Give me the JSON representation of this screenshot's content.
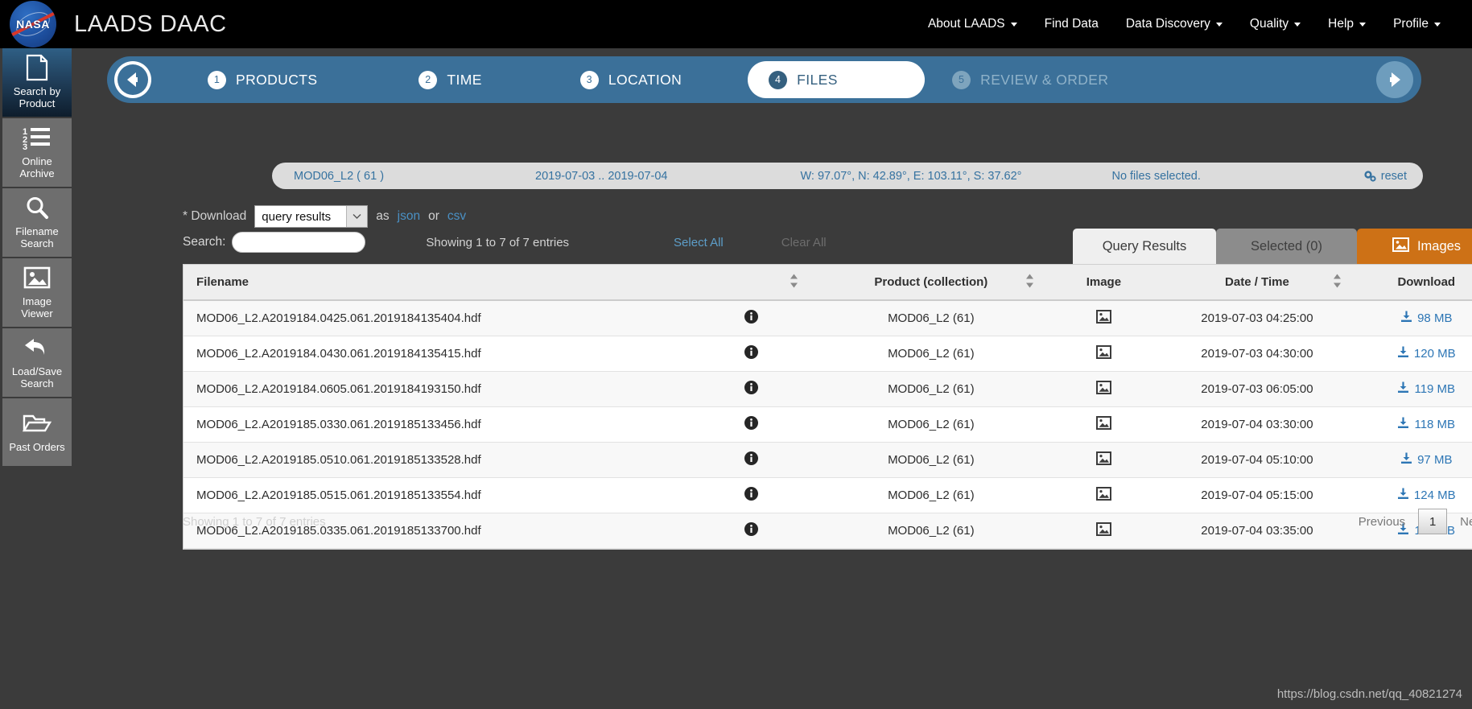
{
  "header": {
    "brand": "LAADS DAAC",
    "logo_text": "NASA",
    "nav": [
      {
        "label": "About LAADS",
        "caret": true
      },
      {
        "label": "Find Data",
        "caret": false
      },
      {
        "label": "Data Discovery",
        "caret": true
      },
      {
        "label": "Quality",
        "caret": true
      },
      {
        "label": "Help",
        "caret": true
      },
      {
        "label": "Profile",
        "caret": true
      }
    ]
  },
  "sidebar": {
    "items": [
      {
        "label_1": "Search by",
        "label_2": "Product",
        "icon": "document-icon",
        "active": true
      },
      {
        "label_1": "Online",
        "label_2": "Archive",
        "icon": "ordered-list-icon",
        "active": false
      },
      {
        "label_1": "Filename",
        "label_2": "Search",
        "icon": "search-icon",
        "active": false
      },
      {
        "label_1": "Image",
        "label_2": "Viewer",
        "icon": "image-icon",
        "active": false
      },
      {
        "label_1": "Load/Save",
        "label_2": "Search",
        "icon": "undo-arrow-icon",
        "active": false
      },
      {
        "label_1": "Past Orders",
        "label_2": "",
        "icon": "folder-open-icon",
        "active": false
      }
    ]
  },
  "stepper": {
    "back_icon": "arrow-left-circle-icon",
    "next_icon": "arrow-right-circle-icon",
    "steps": [
      {
        "num": "1",
        "label": "PRODUCTS",
        "state": "done"
      },
      {
        "num": "2",
        "label": "TIME",
        "state": "done"
      },
      {
        "num": "3",
        "label": "LOCATION",
        "state": "done"
      },
      {
        "num": "4",
        "label": "FILES",
        "state": "current"
      },
      {
        "num": "5",
        "label": "REVIEW & ORDER",
        "state": "disabled"
      }
    ]
  },
  "summary": {
    "product": "MOD06_L2 ( 61 )",
    "time": "2019-07-03 .. 2019-07-04",
    "location": "W: 97.07°, N: 42.89°, E: 103.11°, S: 37.62°",
    "files": "No files selected.",
    "reset": "reset",
    "reset_icon": "gears-icon"
  },
  "download_row": {
    "prefix": "* Download",
    "select_value": "query results",
    "select_options": [
      "query results"
    ],
    "as_text": "as",
    "json_label": "json",
    "or_text": "or",
    "csv_label": "csv",
    "chevron_icon": "chevron-down-icon"
  },
  "search_row": {
    "label": "Search:",
    "value": "",
    "placeholder": "",
    "showing": "Showing 1 to 7 of 7 entries",
    "select_all": "Select All",
    "clear_all": "Clear All"
  },
  "tabs": [
    {
      "label": "Query Results",
      "state": "active"
    },
    {
      "label": "Selected (0)",
      "state": "inactive"
    },
    {
      "label": "Images",
      "state": "images",
      "icon": "image-icon"
    }
  ],
  "table": {
    "columns": [
      {
        "label": "Filename",
        "sortable": true
      },
      {
        "label": "",
        "sortable": false
      },
      {
        "label": "Product (collection)",
        "sortable": true
      },
      {
        "label": "Image",
        "sortable": false
      },
      {
        "label": "Date / Time",
        "sortable": true
      },
      {
        "label": "Download",
        "sortable": false
      }
    ],
    "rows": [
      {
        "filename": "MOD06_L2.A2019184.0425.061.2019184135404.hdf",
        "info_icon": "info-circle-icon",
        "product": "MOD06_L2 (61)",
        "image_icon": "image-icon",
        "datetime": "2019-07-03 04:25:00",
        "size": "98 MB",
        "download_icon": "download-icon"
      },
      {
        "filename": "MOD06_L2.A2019184.0430.061.2019184135415.hdf",
        "info_icon": "info-circle-icon",
        "product": "MOD06_L2 (61)",
        "image_icon": "image-icon",
        "datetime": "2019-07-03 04:30:00",
        "size": "120 MB",
        "download_icon": "download-icon"
      },
      {
        "filename": "MOD06_L2.A2019184.0605.061.2019184193150.hdf",
        "info_icon": "info-circle-icon",
        "product": "MOD06_L2 (61)",
        "image_icon": "image-icon",
        "datetime": "2019-07-03 06:05:00",
        "size": "119 MB",
        "download_icon": "download-icon"
      },
      {
        "filename": "MOD06_L2.A2019185.0330.061.2019185133456.hdf",
        "info_icon": "info-circle-icon",
        "product": "MOD06_L2 (61)",
        "image_icon": "image-icon",
        "datetime": "2019-07-04 03:30:00",
        "size": "118 MB",
        "download_icon": "download-icon"
      },
      {
        "filename": "MOD06_L2.A2019185.0510.061.2019185133528.hdf",
        "info_icon": "info-circle-icon",
        "product": "MOD06_L2 (61)",
        "image_icon": "image-icon",
        "datetime": "2019-07-04 05:10:00",
        "size": "97 MB",
        "download_icon": "download-icon"
      },
      {
        "filename": "MOD06_L2.A2019185.0515.061.2019185133554.hdf",
        "info_icon": "info-circle-icon",
        "product": "MOD06_L2 (61)",
        "image_icon": "image-icon",
        "datetime": "2019-07-04 05:15:00",
        "size": "124 MB",
        "download_icon": "download-icon"
      },
      {
        "filename": "MOD06_L2.A2019185.0335.061.2019185133700.hdf",
        "info_icon": "info-circle-icon",
        "product": "MOD06_L2 (61)",
        "image_icon": "image-icon",
        "datetime": "2019-07-04 03:35:00",
        "size": "117 MB",
        "download_icon": "download-icon"
      }
    ]
  },
  "footer": {
    "showing": "Showing 1 to 7 of 7 entries",
    "previous": "Previous",
    "page": "1",
    "next": "Next"
  },
  "watermark": "https://blog.csdn.net/qq_40821274",
  "colors": {
    "topbar_bg": "#000000",
    "page_bg": "#3b3b3b",
    "stepper_blue": "#3b7099",
    "accent_link": "#3572a0",
    "images_tab": "#cd7116",
    "sidebar_item": "#6e6e6e"
  }
}
